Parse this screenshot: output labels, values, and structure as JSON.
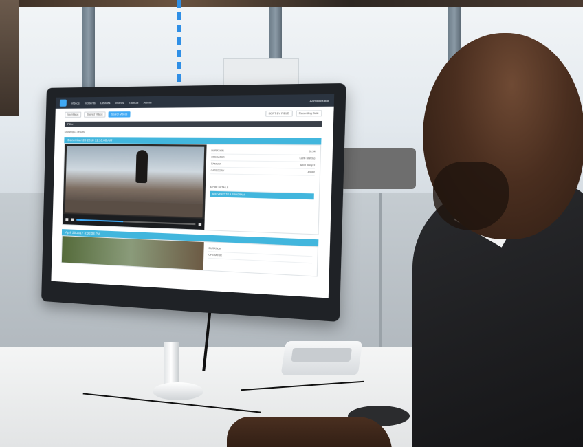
{
  "scene": {
    "description_hidden": "",
    "monitor": {
      "nav_items": [
        "Videos",
        "Incidents",
        "Devices",
        "Videos",
        "Tactical",
        "Admin"
      ],
      "user_label": "Administrator",
      "toolbar": {
        "my_videos": "My Videos",
        "shared_videos": "Shared Videos",
        "search_videos": "Search Videos",
        "sort": "SORT BY FIELD",
        "recording_date": "Recording Date"
      },
      "filter_label": "Filter",
      "showing": "Showing 11 results",
      "record1_date": "December 28 2018 11:16:00 AM",
      "record2_date": "April 25 2017 3:30:08 PM",
      "meta_rows": [
        {
          "k": "DURATION",
          "v": "00:34"
        },
        {
          "k": "OPERATOR",
          "v": "Carlo Moreno"
        },
        {
          "k": "CAMERA",
          "v": "Axon Body 3"
        },
        {
          "k": "CATEGORY",
          "v": "Assist"
        }
      ],
      "more_details": "MORE DETAILS",
      "add_to_case": "ADD VIDEO TO A PROGRAM"
    }
  }
}
